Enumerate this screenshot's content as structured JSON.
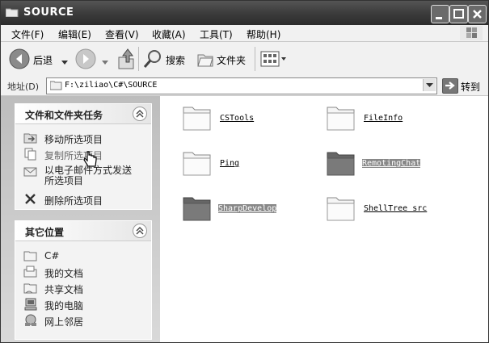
{
  "window": {
    "title": "SOURCE"
  },
  "menu": [
    "文件(F)",
    "编辑(E)",
    "查看(V)",
    "收藏(A)",
    "工具(T)",
    "帮助(H)"
  ],
  "toolbar": {
    "back_label": "后退",
    "search_label": "搜索",
    "folders_label": "文件夹"
  },
  "address": {
    "label": "地址(D)",
    "path": "F:\\ziliao\\C#\\SOURCE",
    "go_label": "转到"
  },
  "tasks_panel": {
    "title": "文件和文件夹任务",
    "items": [
      "移动所选项目",
      "复制所选项目",
      "以电子邮件方式发送所选项目",
      "删除所选项目"
    ]
  },
  "places_panel": {
    "title": "其它位置",
    "items": [
      "C#",
      "我的文档",
      "共享文档",
      "我的电脑",
      "网上邻居"
    ]
  },
  "folders": [
    {
      "name": "CSTools",
      "selected": false
    },
    {
      "name": "FileInfo",
      "selected": false
    },
    {
      "name": "Ping",
      "selected": false
    },
    {
      "name": "RemotingChat",
      "selected": true
    },
    {
      "name": "SharpDevelop",
      "selected": true
    },
    {
      "name": "ShellTree src",
      "selected": false
    }
  ]
}
